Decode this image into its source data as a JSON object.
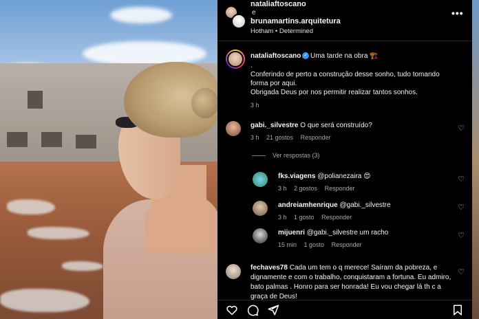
{
  "header": {
    "user1": "nataliaftoscano",
    "conjunction": "e",
    "user2": "brunamartins.arquitetura",
    "song": "Hotham • Determined"
  },
  "caption": {
    "username": "nataliaftoscano",
    "title": "Uma tarde na obra 🏗️",
    "line_dot": ".",
    "line1": "Conferindo de perto a construção desse sonho, tudo tomando",
    "line2": "forma por aqui.",
    "line3": "Obrigada Deus por nos permitir realizar tantos sonhos.",
    "time": "3 h"
  },
  "comments": [
    {
      "username": "gabi._silvestre",
      "text": "O que será construído?",
      "time": "3 h",
      "likes": "21 gostos",
      "reply": "Responder"
    }
  ],
  "view_replies": "Ver respostas (3)",
  "replies": [
    {
      "username": "fks.viagens",
      "text": "@polianezaira 😍",
      "time": "3 h",
      "likes": "2 gostos",
      "reply": "Responder"
    },
    {
      "username": "andreiamhenrique",
      "text": "@gabi._silvestre",
      "time": "3 h",
      "likes": "1 gosto",
      "reply": "Responder"
    },
    {
      "username": "mijuenri",
      "text": "@gabi._silvestre um racho",
      "time": "15 min",
      "likes": "1 gosto",
      "reply": "Responder"
    }
  ],
  "last_comment": {
    "username": "fechaves78",
    "text": "Cada um tem o q merece! Saíram da pobreza, e dignamente e com o trabalho, conquistaram a fortuna. Eu admiro, bato palmas . Honro para ser honrada! Eu vou chegar lá th   c a graça de Deus!"
  },
  "icons": {
    "more": "more-horizontal-icon",
    "heart": "heart-icon",
    "comment": "comment-icon",
    "share": "share-icon",
    "save": "bookmark-icon",
    "verified": "verified-badge-icon"
  },
  "colors": {
    "background": "#000000",
    "text": "#f5f5f5",
    "muted": "#a8a8a8",
    "verified": "#3897f0"
  }
}
